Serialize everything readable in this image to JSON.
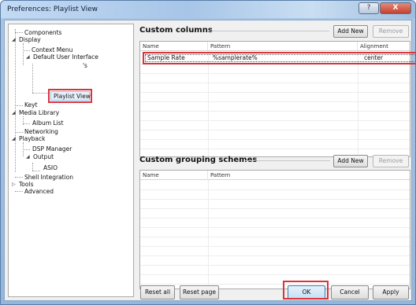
{
  "window": {
    "title": "Preferences: Playlist View",
    "help_label": "?",
    "close_label": "X"
  },
  "tree": {
    "components": "Components",
    "display": "Display",
    "context_menu": "Context Menu",
    "default_ui": "Default User Interface",
    "hidden_child": "'s",
    "playlist_view": "Playlist View",
    "keyboard": "Keyt",
    "media_library": "Media Library",
    "album_list": "Album List",
    "networking": "Networking",
    "playback": "Playback",
    "dsp_manager": "DSP Manager",
    "output": "Output",
    "asio": "ASIO",
    "shell_integration": "Shell Integration",
    "tools": "Tools",
    "advanced": "Advanced"
  },
  "columns_section": {
    "title": "Custom columns",
    "add_new": "Add New",
    "remove": "Remove",
    "headers": [
      "Name",
      "Pattern",
      "Alignment"
    ],
    "rows": [
      {
        "name": "Sample Rate",
        "pattern": "%samplerate%",
        "alignment": "center"
      }
    ]
  },
  "grouping_section": {
    "title": "Custom grouping schemes",
    "add_new": "Add New",
    "remove": "Remove",
    "headers": [
      "Name",
      "Pattern"
    ]
  },
  "footer": {
    "reset_all": "Reset all",
    "reset_page": "Reset page",
    "ok": "OK",
    "cancel": "Cancel",
    "apply": "Apply"
  }
}
